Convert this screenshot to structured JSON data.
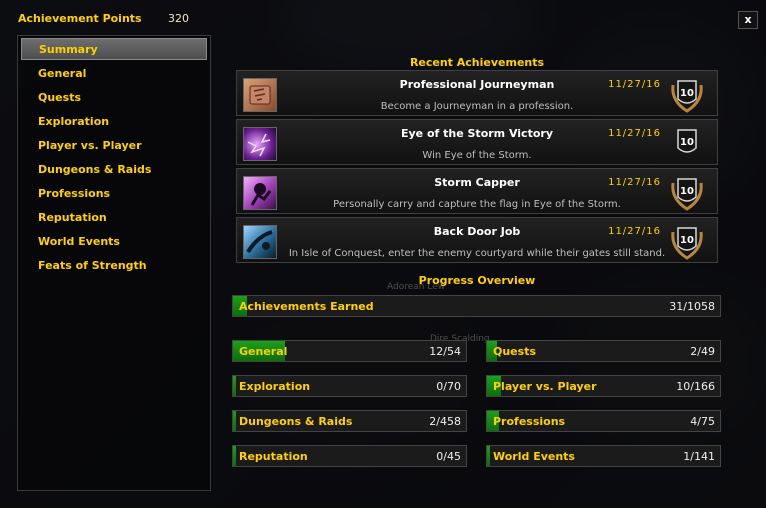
{
  "header": {
    "points_label": "Achievement Points",
    "points_value": "320",
    "close_label": "x"
  },
  "sidebar": {
    "items": [
      {
        "label": "Summary",
        "active": true
      },
      {
        "label": "General"
      },
      {
        "label": "Quests"
      },
      {
        "label": "Exploration"
      },
      {
        "label": "Player vs. Player"
      },
      {
        "label": "Dungeons & Raids"
      },
      {
        "label": "Professions"
      },
      {
        "label": "Reputation"
      },
      {
        "label": "World Events"
      },
      {
        "label": "Feats of Strength"
      }
    ]
  },
  "recent": {
    "title": "Recent Achievements",
    "items": [
      {
        "name": "Professional Journeyman",
        "desc": "Become a Journeyman in a profession.",
        "date": "11/27/16",
        "points": "10",
        "icon": "scroll-icon",
        "color": "#b06a45"
      },
      {
        "name": "Eye of the Storm Victory",
        "desc": "Win Eye of the Storm.",
        "date": "11/27/16",
        "points": "10",
        "icon": "storm-eye-icon",
        "color": "#7a2fa0"
      },
      {
        "name": "Storm Capper",
        "desc": "Personally carry and capture the flag in Eye of the Storm.",
        "date": "11/27/16",
        "points": "10",
        "icon": "flag-runner-icon",
        "color": "#a03fb0"
      },
      {
        "name": "Back Door Job",
        "desc": "In Isle of Conquest, enter the enemy courtyard while their gates still stand.",
        "date": "11/27/16",
        "points": "10",
        "icon": "courtyard-icon",
        "color": "#2b6e9a"
      }
    ]
  },
  "progress": {
    "title": "Progress Overview",
    "total": {
      "label": "Achievements Earned",
      "value": "31/1058",
      "fraction": 0.029
    },
    "categories": [
      {
        "label": "General",
        "value": "12/54",
        "fraction": 0.222
      },
      {
        "label": "Quests",
        "value": "2/49",
        "fraction": 0.041
      },
      {
        "label": "Exploration",
        "value": "0/70",
        "fraction": 0
      },
      {
        "label": "Player vs. Player",
        "value": "10/166",
        "fraction": 0.06
      },
      {
        "label": "Dungeons & Raids",
        "value": "2/458",
        "fraction": 0.004
      },
      {
        "label": "Professions",
        "value": "4/75",
        "fraction": 0.053
      },
      {
        "label": "Reputation",
        "value": "0/45",
        "fraction": 0
      },
      {
        "label": "World Events",
        "value": "1/141",
        "fraction": 0.007
      }
    ]
  },
  "background": {
    "ghost_text_1": "Adorean Lew",
    "ghost_text_2": "Dire Scalding"
  },
  "colors": {
    "accent": "#ffd100",
    "progress": "#1aa01a"
  }
}
